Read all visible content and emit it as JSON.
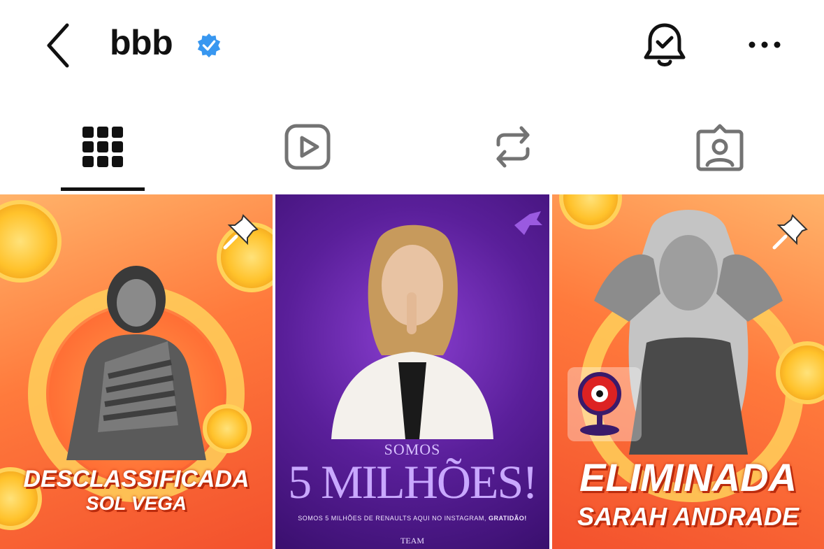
{
  "header": {
    "title": "bbb",
    "verified": true,
    "icons": [
      "back-chevron-icon",
      "verified-badge-icon",
      "bell-check-icon",
      "more-horizontal-icon"
    ]
  },
  "tabs": [
    {
      "name": "grid-posts",
      "icon": "grid-icon",
      "active": true
    },
    {
      "name": "reels",
      "icon": "reels-play-icon",
      "active": false
    },
    {
      "name": "reposts",
      "icon": "repost-icon",
      "active": false
    },
    {
      "name": "tagged",
      "icon": "tagged-person-icon",
      "active": false
    }
  ],
  "posts": [
    {
      "headline": "DESCLASSIFICADA",
      "subline": "SOL VEGA",
      "pinned": true
    },
    {
      "top": "SOMOS",
      "headline": "5 MILHÕES!",
      "caption_text": "SOMOS 5 MILHÕES DE RENAULTS AQUI NO INSTAGRAM, ",
      "caption_bold": "GRATIDÃO!",
      "footer": "TEAM",
      "pinned": false
    },
    {
      "headline": "ELIMINADA",
      "subline": "SARAH ANDRADE",
      "pinned": true
    }
  ],
  "colors": {
    "verified": "#3897f0",
    "active_tab": "#111111",
    "icon_gray": "#737373",
    "orange": "#ff7a3c",
    "purple": "#5a1f9a"
  }
}
